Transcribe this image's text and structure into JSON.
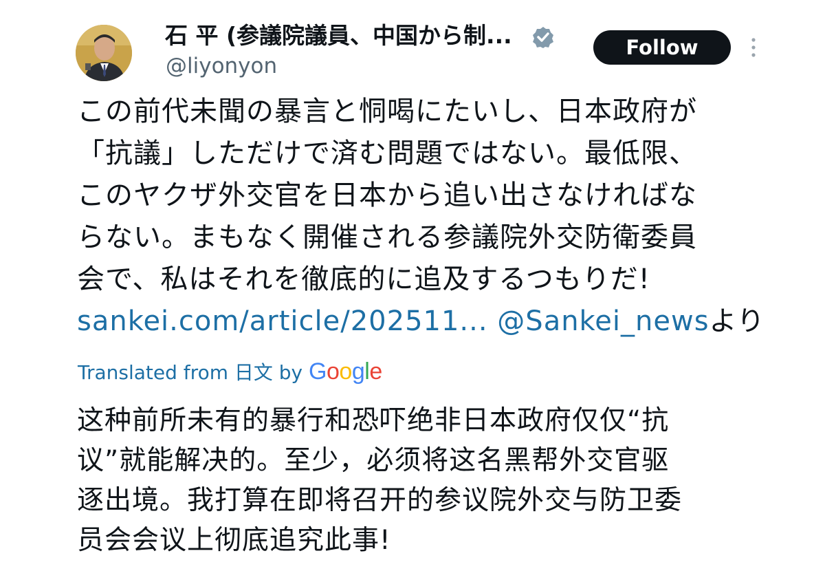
{
  "header": {
    "display_name": "石 平 (参議院議員、中国から制...",
    "handle": "@liyonyon",
    "follow_label": "Follow"
  },
  "tweet": {
    "lines": [
      "この前代未聞の暴言と恫喝にたいし、日本政府が",
      "「抗議」しただけで済む問題ではない。最低限、",
      "このヤクザ外交官を日本から追い出さなければな",
      "らない。まもなく開催される参議院外交防衛委員",
      "会で、私はそれを徹底的に追及するつもりだ!"
    ],
    "link_url": "sankei.com/article/202511...",
    "mention": "@Sankei_news",
    "suffix": "より"
  },
  "translation": {
    "label": "Translated from 日文 by",
    "provider": "Google",
    "lines": [
      "这种前所未有的暴行和恐吓绝非日本政府仅仅“抗",
      "议”就能解决的。至少，必须将这名黑帮外交官驱",
      "逐出境。我打算在即将召开的参议院外交与防卫委",
      "员会会议上彻底追究此事!"
    ]
  },
  "colors": {
    "link": "#1d6fa5",
    "follow_bg": "#0f1419",
    "handle": "#536471"
  },
  "icons": {
    "verified": "verified-badge-icon",
    "more": "more-options-icon"
  }
}
